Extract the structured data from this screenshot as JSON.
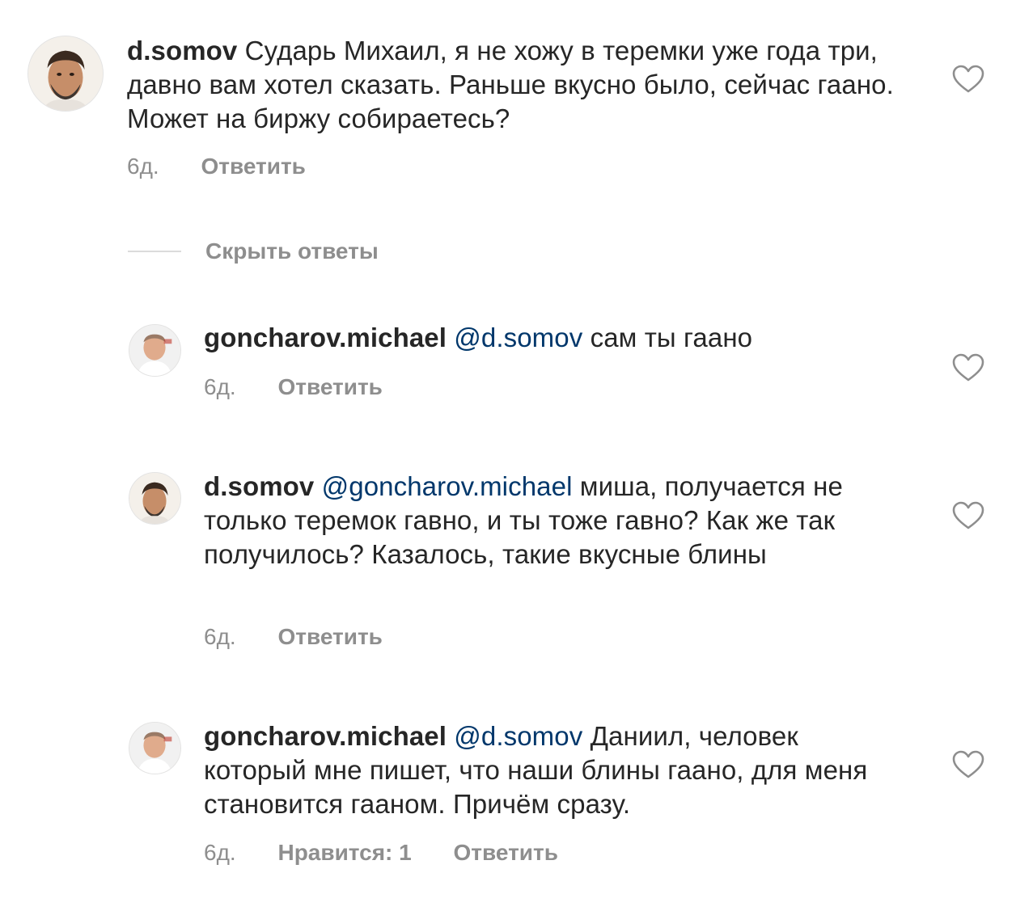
{
  "colors": {
    "text": "#262626",
    "secondary": "#8e8e8e",
    "mention": "#00376b",
    "divider": "#dbdbdb"
  },
  "comments": [
    {
      "username": "d.somov",
      "mention": "",
      "body": "Сударь Михаил, я не хожу в теремки уже года три, давно вам хотел сказать. Раньше вкусно было, сейчас гаано. Может на биржу собираетесь?",
      "time": "6д.",
      "likes_label": "",
      "reply_label": "Ответить",
      "avatar_icon": "user-avatar-dsomov",
      "like_icon": "heart-outline-icon"
    },
    {
      "username": "goncharov.michael",
      "mention": "@d.somov",
      "body": "сам ты гаано",
      "time": "6д.",
      "likes_label": "",
      "reply_label": "Ответить",
      "avatar_icon": "user-avatar-goncharov",
      "like_icon": "heart-outline-icon"
    },
    {
      "username": "d.somov",
      "mention": "@goncharov.michael",
      "body": "миша, получается не только теремок гавно, и ты тоже гавно? Как же так получилось? Казалось, такие вкусные блины",
      "time": "6д.",
      "likes_label": "",
      "reply_label": "Ответить",
      "avatar_icon": "user-avatar-dsomov",
      "like_icon": "heart-outline-icon"
    },
    {
      "username": "goncharov.michael",
      "mention": "@d.somov",
      "body": "Даниил, человек который мне пишет, что наши блины гаано, для меня становится гааном. Причём сразу.",
      "time": "6д.",
      "likes_label": "Нравится: 1",
      "reply_label": "Ответить",
      "avatar_icon": "user-avatar-goncharov",
      "like_icon": "heart-outline-icon"
    }
  ],
  "replies_toggle": {
    "label": "Скрыть ответы"
  }
}
